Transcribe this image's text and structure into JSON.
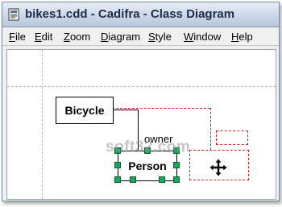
{
  "window": {
    "title": "bikes1.cdd - Cadifra - Class Diagram"
  },
  "menu": {
    "items": [
      {
        "label": "File",
        "mnemonic": "F",
        "rest": "ile"
      },
      {
        "label": "Edit",
        "mnemonic": "E",
        "rest": "dit"
      },
      {
        "label": "Zoom",
        "mnemonic": "Z",
        "rest": "oom"
      },
      {
        "label": "Diagram",
        "mnemonic": "D",
        "rest": "iagram"
      },
      {
        "label": "Style",
        "mnemonic": "S",
        "rest": "tyle"
      },
      {
        "label": "Window",
        "mnemonic": "W",
        "rest": "indow"
      },
      {
        "label": "Help",
        "mnemonic": "H",
        "rest": "elp"
      }
    ]
  },
  "diagram": {
    "classes": [
      {
        "name": "Bicycle"
      },
      {
        "name": "Person"
      }
    ],
    "association_label": "owner"
  },
  "watermark": "soft32.com",
  "colors": {
    "selection_handle": "#1aa85a",
    "drag_outline": "#e02020",
    "titlebar": "#c9d5e6"
  }
}
